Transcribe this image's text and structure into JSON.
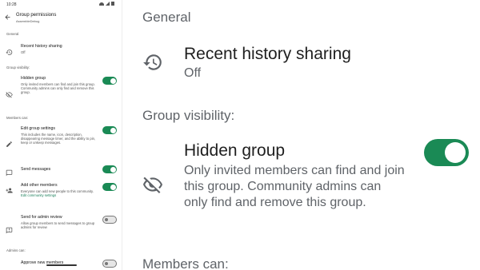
{
  "status_bar": {
    "time": "10:28"
  },
  "app_bar": {
    "title": "Group permissions",
    "subtitle": "AssembleDebug"
  },
  "sections": {
    "general": "General",
    "group_visibility": "Group visibility:",
    "members_can": "Members can:",
    "admins_can": "Admins can:"
  },
  "settings": {
    "recent_history": {
      "title": "Recent history sharing",
      "value": "Off",
      "icon": "history-icon"
    },
    "hidden_group": {
      "title": "Hidden group",
      "desc": "Only invited members can find and join this group. Community admins can only find and remove this group.",
      "icon": "eye-off-icon",
      "enabled": true
    },
    "edit_group_settings": {
      "title": "Edit group settings",
      "desc": "This includes the name, icon, description, disappearing message timer, and the ability to pin, keep or unkeep messages.",
      "icon": "pencil-icon",
      "enabled": true
    },
    "send_messages": {
      "title": "Send messages",
      "icon": "chat-icon",
      "enabled": true
    },
    "add_other_members": {
      "title": "Add other members",
      "desc": "Everyone can add new people to this community.",
      "link": "Edit community settings",
      "icon": "add-person-icon",
      "enabled": true
    },
    "send_for_admin_review": {
      "title": "Send for admin review",
      "desc": "Allow group members to send messages to group admins for review",
      "icon": "review-icon",
      "enabled": false
    },
    "approve_new_members": {
      "title": "Approve new members",
      "enabled": false
    }
  },
  "colors": {
    "accent": "#1a8a55",
    "link": "#1a7f5a",
    "text_secondary": "#5f6368"
  }
}
